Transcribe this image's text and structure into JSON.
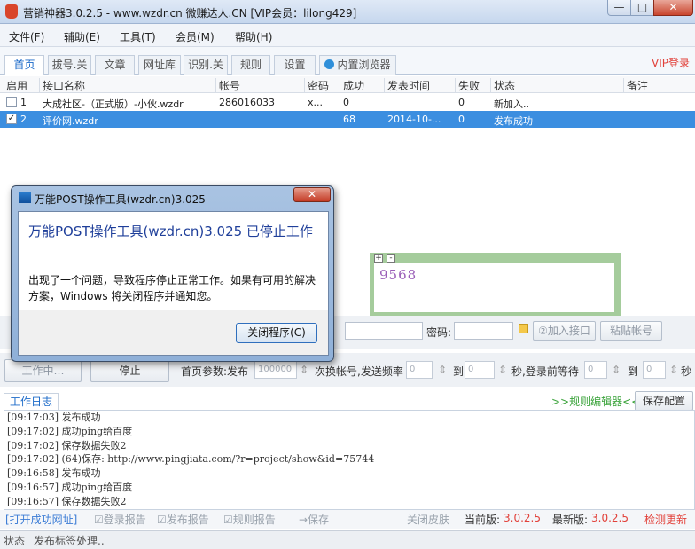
{
  "window": {
    "title": "营销神器3.0.2.5 - www.wzdr.cn 微赚达人.CN [VIP会员：lilong429]",
    "min_label": "—",
    "max_label": "□",
    "close_label": "✕"
  },
  "menu": [
    "文件(F)",
    "辅助(E)",
    "工具(T)",
    "会员(M)",
    "帮助(H)"
  ],
  "tabs": [
    "首页",
    "拔号.关",
    "文章",
    "网址库",
    "识别.关",
    "规则",
    "设置",
    "内置浏览器"
  ],
  "vip_login": "VIP登录",
  "table": {
    "headers": [
      "启用",
      "接口名称",
      "帐号",
      "密码",
      "成功",
      "发表时间",
      "失败",
      "状态",
      "备注"
    ],
    "rows": [
      {
        "num": "1",
        "checked": "",
        "name": "大成社区-（正式版）-小伙.wzdr",
        "account": "286016033",
        "password": "x...",
        "success": "0",
        "time": "",
        "fail": "0",
        "status": "新加入..",
        "note": ""
      },
      {
        "num": "2",
        "checked": "✓",
        "name": "评价网.wzdr",
        "account": "",
        "password": "",
        "success": "68",
        "time": "2014-10-...",
        "fail": "0",
        "status": "发布成功",
        "note": ""
      }
    ]
  },
  "captcha": {
    "code": "9568",
    "expand": "+",
    "collapse": "-"
  },
  "account_form": {
    "password_label": "密码:",
    "add_button": "②加入接口",
    "paste_button": "粘贴帐号"
  },
  "controls": {
    "working_button": "工作中…",
    "stop_button": "停止",
    "home_params_label": "首页参数:发布",
    "publish_value": "100000",
    "switch_label": "次换帐号,发送频率",
    "freq_from": "0",
    "to_label_1": "到",
    "freq_to": "0",
    "sec_login_wait": "秒,登录前等待",
    "wait_from": "0",
    "to_label_2": "到",
    "wait_to": "0",
    "sec_label": "秒"
  },
  "log": {
    "tab_label": "工作日志",
    "rule_editor": ">>规则编辑器<<",
    "save_config": "保存配置",
    "lines": [
      "[09:17:03] 发布成功",
      "[09:17:02] 成功ping给百度",
      "[09:17:02] 保存数据失败2",
      "[09:17:02] (64)保存: http://www.pingjiata.com/?r=project/show&id=75744",
      "[09:16:58] 发布成功",
      "[09:16:57] 成功ping给百度",
      "[09:16:57] 保存数据失败2"
    ]
  },
  "options": {
    "open_success": "[打开成功网址]",
    "login_report": "☑登录报告",
    "publish_report": "☑发布报告",
    "rule_report": "☑规则报告",
    "save": "→保存",
    "close_skin": "关闭皮肤",
    "current_label": "当前版:",
    "current_version": "3.0.2.5",
    "latest_label": "最新版:",
    "latest_version": "3.0.2.5",
    "check_update": "检测更新"
  },
  "statusbar": {
    "label": "状态",
    "text": "发布标签处理.."
  },
  "dialog": {
    "title": "万能POST操作工具(wzdr.cn)3.025",
    "close": "✕",
    "heading": "万能POST操作工具(wzdr.cn)3.025 已停止工作",
    "message": "出现了一个问题，导致程序停止正常工作。如果有可用的解决方案，Windows 将关闭程序并通知您。",
    "button": "关闭程序(C)"
  },
  "colors": {
    "accent": "#1b6ac9",
    "selected_row": "#3b8ee0",
    "vip": "#e2413a",
    "rule_editor": "#3aa33a"
  }
}
